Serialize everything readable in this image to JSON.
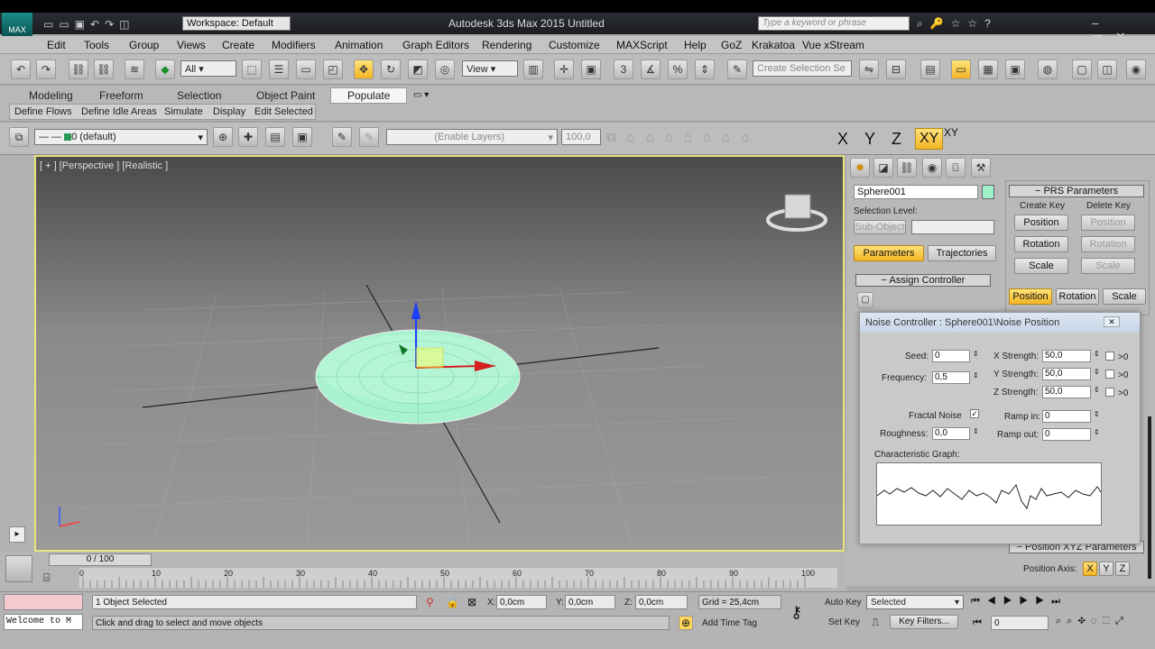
{
  "titlebar": {
    "workspace": "Workspace: Default",
    "title": "Autodesk 3ds Max  2015     Untitled",
    "search_placeholder": "Type a keyword or phrase"
  },
  "menu": [
    "Edit",
    "Tools",
    "Group",
    "Views",
    "Create",
    "Modifiers",
    "Animation",
    "Graph Editors",
    "Rendering",
    "Customize",
    "MAXScript",
    "Help",
    "GoZ",
    "Krakatoa",
    "Vue xStream"
  ],
  "maintoolbar": {
    "filter": "All",
    "refcoord": "View",
    "selection_set_placeholder": "Create Selection Se"
  },
  "ribbon": {
    "tabs": [
      "Modeling",
      "Freeform",
      "Selection",
      "Object Paint",
      "Populate"
    ],
    "active_tab": "Populate",
    "subtabs": [
      "Define Flows",
      "Define Idle Areas",
      "Simulate",
      "Display",
      "Edit Selected"
    ]
  },
  "layerbar": {
    "layer": "0 (default)",
    "enable_layers": "(Enable Layers)",
    "percent": "100,0"
  },
  "axes": {
    "x": "X",
    "y": "Y",
    "z": "Z",
    "xy": "XY",
    "xy2": "XY"
  },
  "viewport": {
    "label": "[ + ] [Perspective ] [Realistic ]"
  },
  "cmdpanel": {
    "object_name": "Sphere001",
    "object_color": "#9ff0c8",
    "selection_level": "Selection Level:",
    "sub_object": "Sub-Object",
    "parameters": "Parameters",
    "trajectories": "Trajectories",
    "assign_controller": "Assign Controller",
    "prs_title": "PRS Parameters",
    "create_key": "Create Key",
    "delete_key": "Delete Key",
    "position": "Position",
    "rotation": "Rotation",
    "scale": "Scale",
    "position_xyz": "Position XYZ Parameters",
    "position_axis": "Position Axis:",
    "axis_x": "X",
    "axis_y": "Y",
    "axis_z": "Z"
  },
  "noise": {
    "title": "Noise Controller : Sphere001\\Noise Position",
    "seed_label": "Seed:",
    "seed": "0",
    "frequency_label": "Frequency:",
    "frequency": "0,5",
    "fractal_label": "Fractal Noise",
    "roughness_label": "Roughness:",
    "roughness": "0,0",
    "xs_label": "X Strength:",
    "xs": "50,0",
    "ys_label": "Y Strength:",
    "ys": "50,0",
    "zs_label": "Z Strength:",
    "zs": "50,0",
    "gt0": ">0",
    "rampin_label": "Ramp in:",
    "rampin": "0",
    "rampout_label": "Ramp out:",
    "rampout": "0",
    "graph_label": "Characteristic Graph:"
  },
  "timeline": {
    "frame": "0 / 100",
    "ticks": [
      "0",
      "10",
      "20",
      "30",
      "40",
      "50",
      "60",
      "70",
      "80",
      "90",
      "100"
    ]
  },
  "status": {
    "welcome": "Welcome to M",
    "selected": "1 Object Selected",
    "hint": "Click and drag to select and move objects",
    "x_label": "X:",
    "x": "0,0cm",
    "y_label": "Y:",
    "y": "0,0cm",
    "z_label": "Z:",
    "z": "0,0cm",
    "grid": "Grid = 25,4cm",
    "add_time_tag": "Add Time Tag",
    "auto_key": "Auto Key",
    "set_key": "Set Key",
    "selected_dd": "Selected",
    "key_filters": "Key Filters...",
    "frame": "0"
  }
}
